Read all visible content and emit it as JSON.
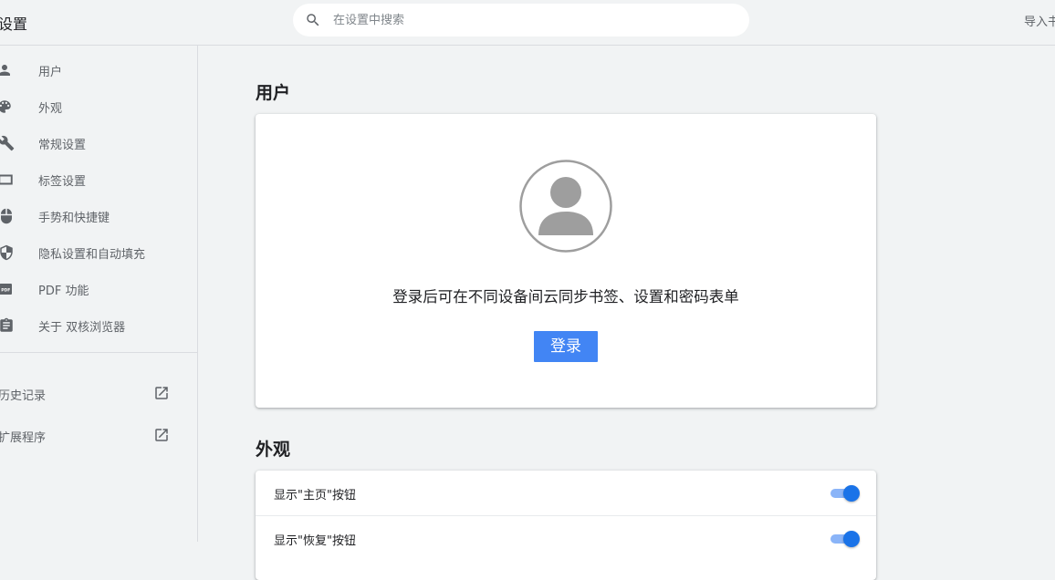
{
  "header": {
    "title": "设置",
    "search_placeholder": "在设置中搜索",
    "import_link": "导入书"
  },
  "sidebar": {
    "items": [
      {
        "label": "用户",
        "icon": "person-icon"
      },
      {
        "label": "外观",
        "icon": "palette-icon"
      },
      {
        "label": "常规设置",
        "icon": "wrench-icon"
      },
      {
        "label": "标签设置",
        "icon": "tab-icon"
      },
      {
        "label": "手势和快捷键",
        "icon": "mouse-icon"
      },
      {
        "label": "隐私设置和自动填充",
        "icon": "shield-icon"
      },
      {
        "label": "PDF 功能",
        "icon": "pdf-icon"
      },
      {
        "label": "关于 双核浏览器",
        "icon": "clipboard-icon"
      }
    ],
    "external": [
      {
        "label": "历史记录",
        "icon": "open-in-new-icon"
      },
      {
        "label": "扩展程序",
        "icon": "open-in-new-icon"
      }
    ]
  },
  "main": {
    "user_section": {
      "title": "用户",
      "signin_text": "登录后可在不同设备间云同步书签、设置和密码表单",
      "signin_button": "登录"
    },
    "appearance_section": {
      "title": "外观",
      "settings": [
        {
          "label": "显示\"主页\"按钮",
          "enabled": true
        },
        {
          "label": "显示\"恢复\"按钮",
          "enabled": true
        }
      ]
    }
  },
  "colors": {
    "accent": "#4285f4",
    "toggle_on": "#1a73e8",
    "background": "#f1f3f4"
  }
}
